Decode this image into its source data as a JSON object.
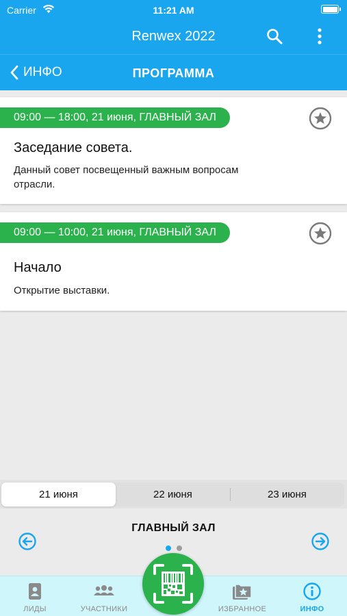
{
  "status_bar": {
    "carrier": "Carrier",
    "time": "11:21 AM"
  },
  "app_bar": {
    "title": "Renwex 2022",
    "icons": [
      "search-icon",
      "more-vertical-icon"
    ]
  },
  "sub_bar": {
    "back_label": "ИНФО",
    "title": "ПРОГРАММА"
  },
  "events": [
    {
      "time": "09:00 — 18:00, 21 июня, ГЛАВНЫЙ ЗАЛ",
      "name": "Заседание совета.",
      "description": "Данный совет посвещенный важным вопросам отрасли."
    },
    {
      "time": "09:00 — 10:00, 21 июня, ГЛАВНЫЙ ЗАЛ",
      "name": "Начало",
      "description": "Открытие выставки."
    }
  ],
  "days": {
    "selected": "21 июня",
    "items": [
      "21 июня",
      "22 июня",
      "23 июня"
    ]
  },
  "hall": {
    "name": "ГЛАВНЫЙ ЗАЛ",
    "page_count": 2,
    "current_page": 1
  },
  "tabs": [
    {
      "label": "ЛИДЫ",
      "icon": "contact-card-icon",
      "active": false
    },
    {
      "label": "УЧАСТНИКИ",
      "icon": "people-icon",
      "active": false
    },
    {
      "label": "",
      "icon": "qr-scan-icon",
      "active": false
    },
    {
      "label": "ИЗБРАННОЕ",
      "icon": "favorites-folder-icon",
      "active": false
    },
    {
      "label": "ИНФО",
      "icon": "info-icon",
      "active": true
    }
  ],
  "colors": {
    "primary": "#1aa6ee",
    "accent_green": "#2bb24c",
    "tabbar_bg": "#cff6fb"
  }
}
